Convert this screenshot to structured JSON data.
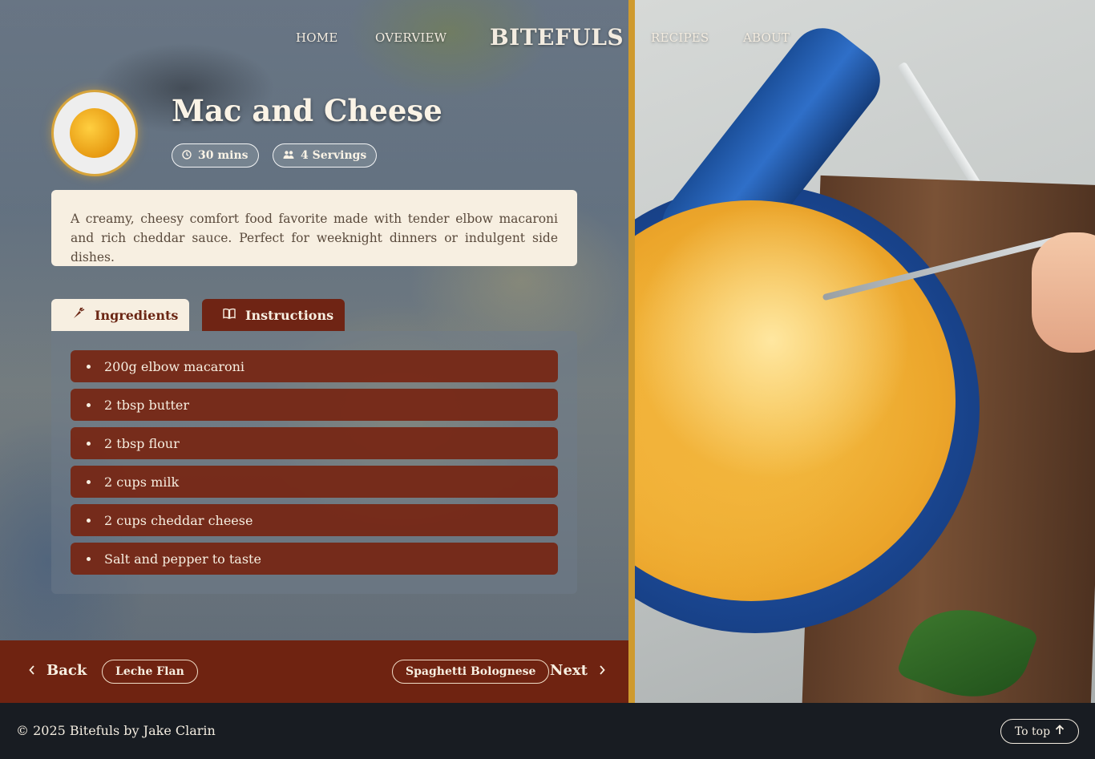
{
  "nav": {
    "home": "HOME",
    "overview": "OVERVIEW",
    "brand": "BITEFULS",
    "recipes": "RECIPES",
    "about": "ABOUT"
  },
  "recipe": {
    "title": "Mac and Cheese",
    "time": "30 mins",
    "servings": "4 Servings",
    "description": "A creamy, cheesy comfort food favorite made with tender elbow macaroni and rich cheddar sauce. Perfect for weeknight dinners or indulgent side dishes."
  },
  "tabs": {
    "ingredients": "Ingredients",
    "instructions": "Instructions"
  },
  "ingredients": [
    "200g elbow macaroni",
    "2 tbsp butter",
    "2 tbsp flour",
    "2 cups milk",
    "2 cups cheddar cheese",
    "Salt and pepper to taste"
  ],
  "pager": {
    "back": "Back",
    "prev_recipe": "Leche Flan",
    "next_recipe": "Spaghetti Bolognese",
    "next": "Next"
  },
  "footer": {
    "copyright": "© 2025 Bitefuls by Jake Clarin",
    "to_top": "To top"
  },
  "colors": {
    "accent_gold": "#cf9a2e",
    "maroon": "#6f2311",
    "cream": "#f7efe1",
    "footer_bg": "#181c22"
  },
  "icons": {
    "time": "clock-icon",
    "servings": "users-icon",
    "ingredients": "carrot-icon",
    "instructions": "book-icon",
    "back": "chevron-left-icon",
    "next": "chevron-right-icon",
    "to_top": "arrow-up-icon"
  }
}
